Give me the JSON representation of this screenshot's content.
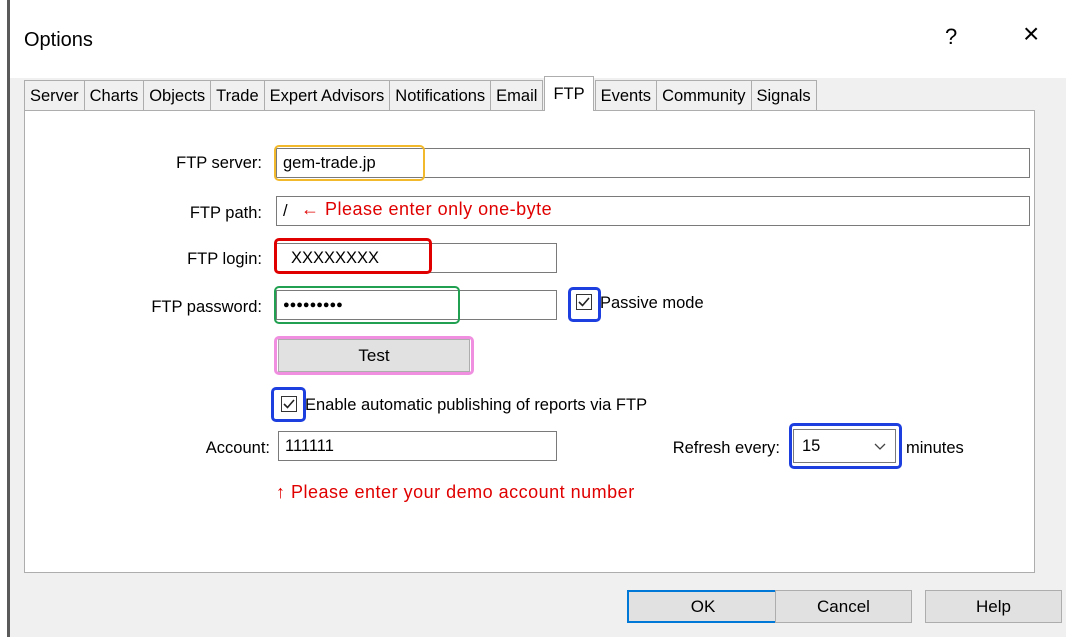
{
  "window": {
    "title": "Options",
    "help_label": "?",
    "close_label": "×"
  },
  "tabs": [
    {
      "label": "Server"
    },
    {
      "label": "Charts"
    },
    {
      "label": "Objects"
    },
    {
      "label": "Trade"
    },
    {
      "label": "Expert Advisors"
    },
    {
      "label": "Notifications"
    },
    {
      "label": "Email"
    },
    {
      "label": "FTP",
      "active": true
    },
    {
      "label": "Events"
    },
    {
      "label": "Community"
    },
    {
      "label": "Signals"
    }
  ],
  "ftp": {
    "server_label": "FTP server:",
    "server_value": "gem-trade.jp",
    "path_label": "FTP path:",
    "path_value": "/",
    "login_label": "FTP login:",
    "login_value": "XXXXXXXX",
    "password_label": "FTP password:",
    "password_value": "●●●●●●●●●",
    "passive_label": "Passive mode",
    "passive_checked": true,
    "test_label": "Test",
    "enable_label": "Enable automatic publishing of reports via FTP",
    "enable_checked": true,
    "account_label": "Account:",
    "account_value": "111111",
    "refresh_label": "Refresh every:",
    "refresh_value": "15",
    "minutes_label": "minutes"
  },
  "annotations": {
    "path_note": "← Please enter only one-byte",
    "account_note": "↑ Please enter your demo account number",
    "colors": {
      "server": "#f2b92c",
      "login": "#e00000",
      "password": "#20a050",
      "checkbox": "#1d3fe0",
      "test": "#f08ee0",
      "note_text": "#e00000"
    }
  },
  "footer": {
    "ok_label": "OK",
    "cancel_label": "Cancel",
    "help_label": "Help"
  }
}
